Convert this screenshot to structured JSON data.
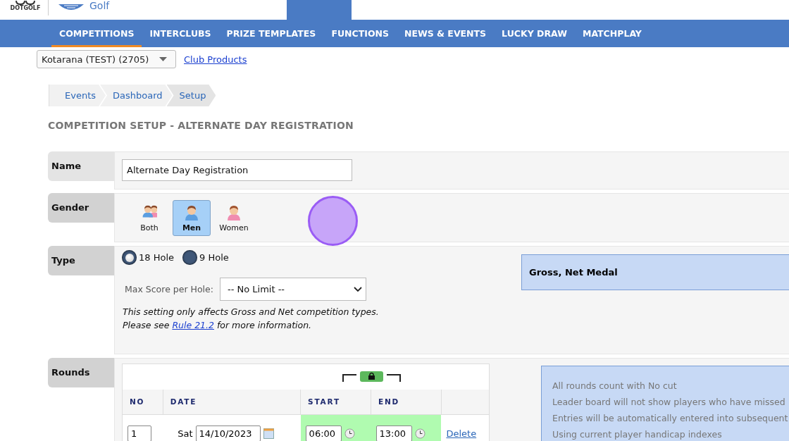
{
  "top_nav": {
    "logo_text": "DOTGOLF",
    "brand": "Golf"
  },
  "sub_nav": [
    {
      "label": "COMPETITIONS",
      "selected": true
    },
    {
      "label": "INTERCLUBS",
      "selected": false
    },
    {
      "label": "PRIZE TEMPLATES",
      "selected": false
    },
    {
      "label": "FUNCTIONS",
      "selected": false
    },
    {
      "label": "NEWS & EVENTS",
      "selected": false
    },
    {
      "label": "LUCKY DRAW",
      "selected": false
    },
    {
      "label": "MATCHPLAY",
      "selected": false
    }
  ],
  "club_select": {
    "value": "Kotarana (TEST) (2705)"
  },
  "club_products_link": "Club Products",
  "breadcrumbs": [
    {
      "label": "Events",
      "selected": false
    },
    {
      "label": "Dashboard",
      "selected": false
    },
    {
      "label": "Setup",
      "selected": true
    }
  ],
  "page_title": "COMPETITION SETUP - ALTERNATE DAY REGISTRATION",
  "name_field": {
    "label": "Name",
    "value": "Alternate Day Registration"
  },
  "gender": {
    "label": "Gender",
    "options": [
      {
        "label": "Both",
        "kind": "both",
        "selected": false
      },
      {
        "label": "Men",
        "kind": "men",
        "selected": true
      },
      {
        "label": "Women",
        "kind": "women",
        "selected": false
      }
    ]
  },
  "type": {
    "label": "Type",
    "options": [
      {
        "label": "18 Hole",
        "selected": true
      },
      {
        "label": "9 Hole",
        "selected": false
      }
    ],
    "max_score_label": "Max Score per Hole:",
    "max_score_value": "-- No Limit --",
    "note": "This setting only affects Gross and Net competition types.",
    "note_2_before": "Please see ",
    "rule_link": "Rule 21.2",
    "note_2_after": " for more information.",
    "summary": "Gross, Net Medal"
  },
  "rounds": {
    "label": "Rounds",
    "locked": true,
    "columns": [
      "NO",
      "DATE",
      "START",
      "END"
    ],
    "rows": [
      {
        "no": "1",
        "day": "Sat",
        "date": "14/10/2023",
        "start": "06:00",
        "end": "13:00",
        "action": "Delete"
      }
    ],
    "info": [
      "All rounds count with No cut",
      "Leader board will not show players who have missed",
      "Entries will be automatically entered into subsequent",
      "Using current player handicap indexes"
    ]
  }
}
